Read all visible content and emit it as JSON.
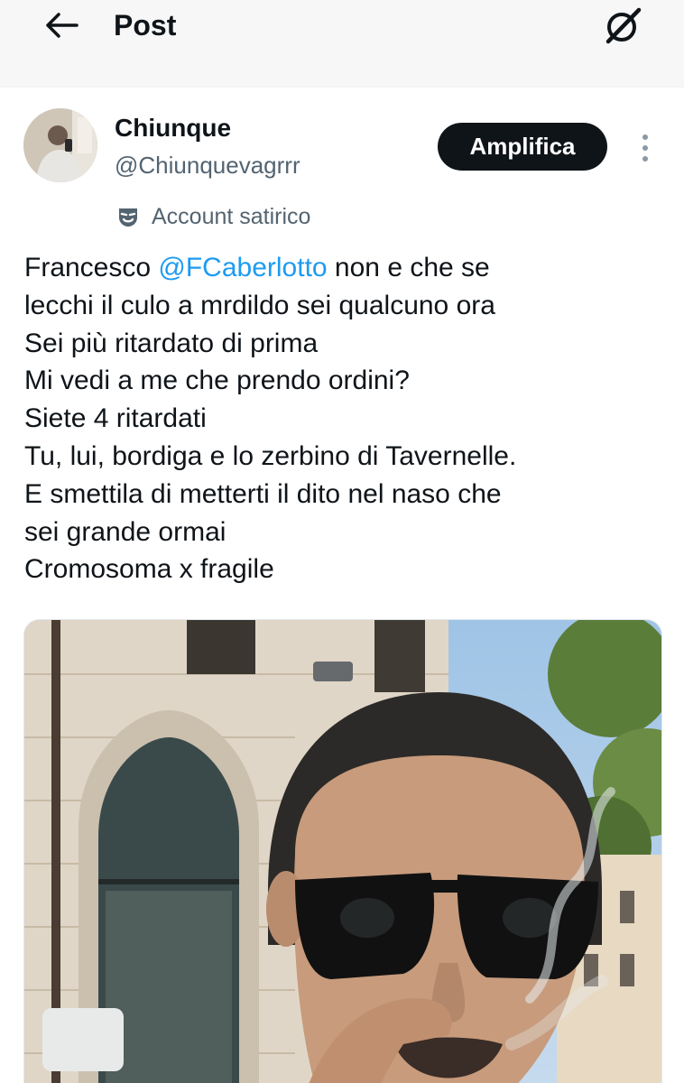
{
  "header": {
    "title": "Post",
    "back_icon": "arrow-left-icon",
    "grok_icon": "grok-icon"
  },
  "author": {
    "display_name": "Chiunque",
    "handle": "@Chiunquevagrrr",
    "label": "Account satirico",
    "label_icon": "mask-icon",
    "avatar_icon": "avatar"
  },
  "actions": {
    "follow_label": "Amplifica",
    "more_icon": "more-vertical-icon"
  },
  "tweet": {
    "line1_prefix": "Francesco ",
    "mention": "@FCaberlotto",
    "line1_suffix": " non e che se",
    "line2": "lecchi il culo a mrdildo sei qualcuno ora",
    "line3": "Sei più ritardato di prima",
    "line4": "Mi vedi a me che prendo ordini?",
    "line5": "Siete 4 ritardati",
    "line6": "Tu, lui, bordiga e lo zerbino di Tavernelle.",
    "line7": "E smettila di metterti il dito nel naso che",
    "line8": "sei grande ormai",
    "line9": "Cromosoma x fragile"
  },
  "colors": {
    "text": "#0f1419",
    "secondary": "#536471",
    "link": "#1d9bf0",
    "button_bg": "#0f1419",
    "button_text": "#ffffff"
  }
}
